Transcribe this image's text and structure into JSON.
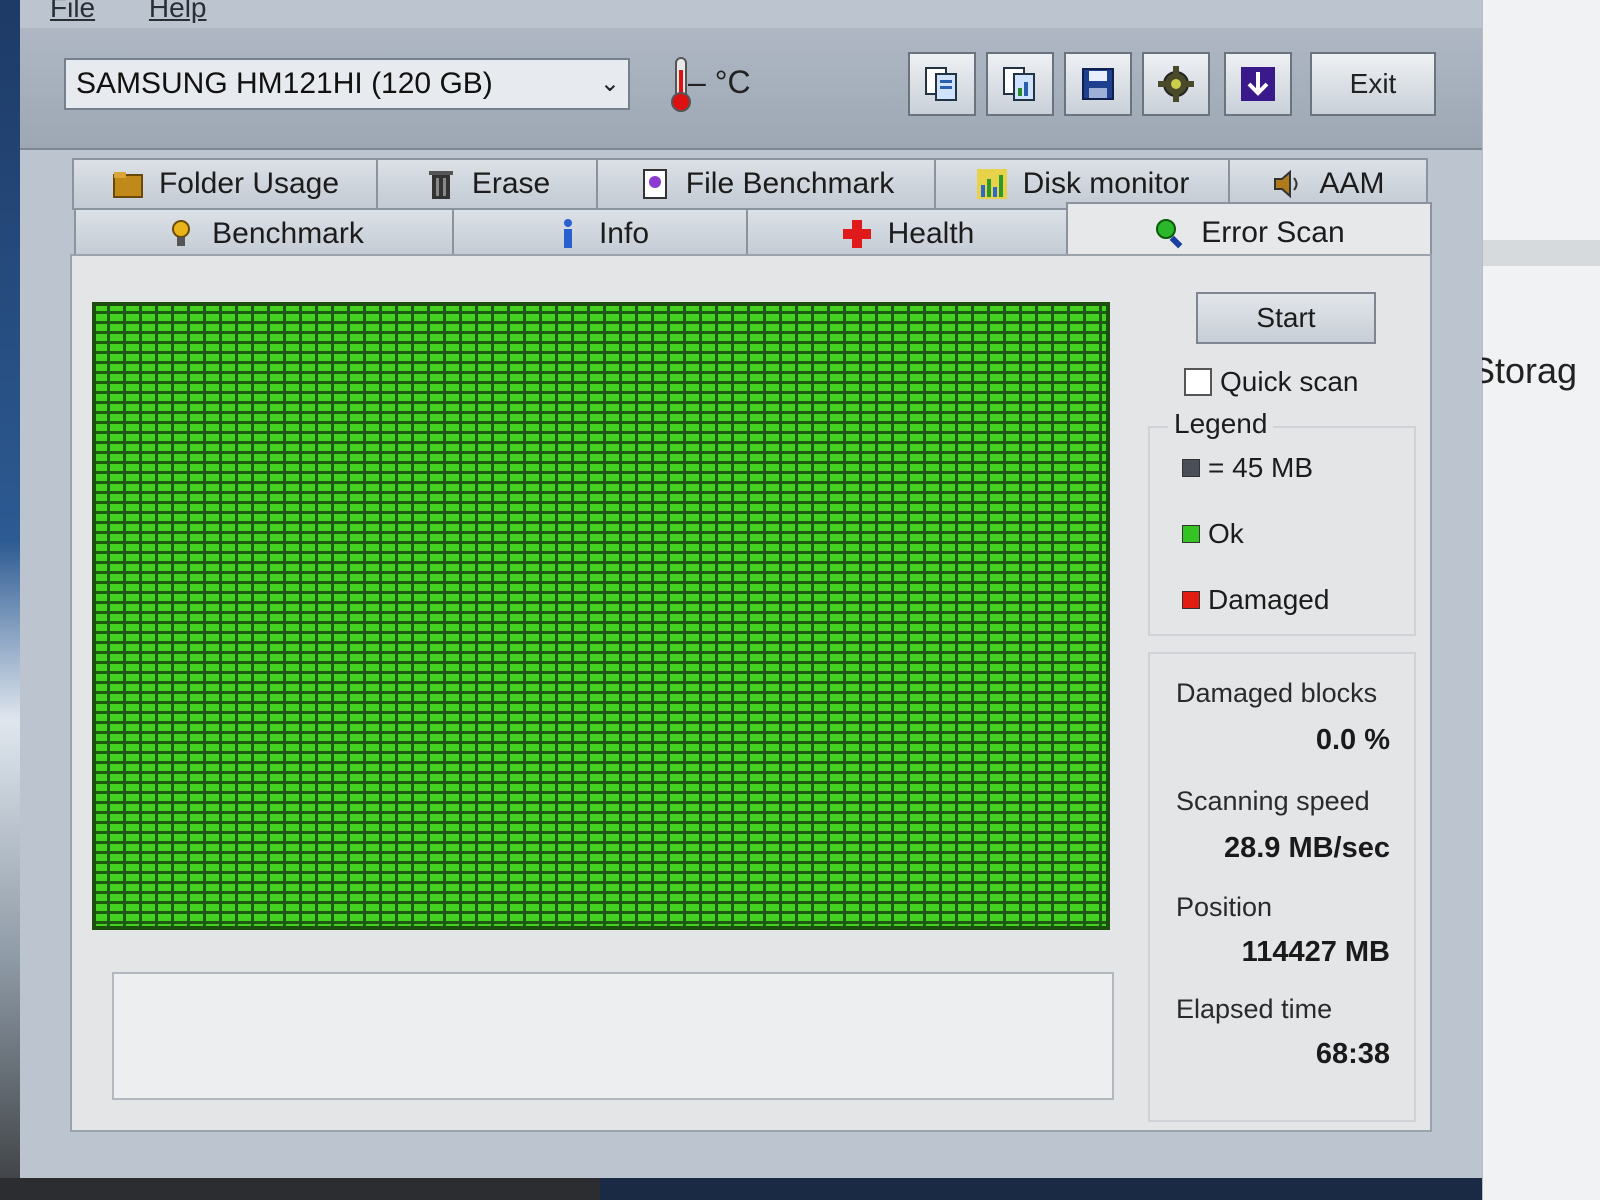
{
  "menu": {
    "file": "File",
    "help": "Help"
  },
  "toolbar": {
    "drive": "SAMSUNG HM121HI (120 GB)",
    "temperature": "– °C",
    "exit_label": "Exit",
    "buttons": [
      "copy-info-icon",
      "copy-screen-icon",
      "save-icon",
      "options-icon",
      "download-icon"
    ]
  },
  "tabs_top": [
    {
      "label": "Folder Usage",
      "icon": "folder-icon"
    },
    {
      "label": "Erase",
      "icon": "trash-icon"
    },
    {
      "label": "File Benchmark",
      "icon": "file-benchmark-icon"
    },
    {
      "label": "Disk monitor",
      "icon": "chart-icon"
    },
    {
      "label": "AAM",
      "icon": "speaker-icon"
    }
  ],
  "tabs_bottom": [
    {
      "label": "Benchmark",
      "icon": "bulb-icon"
    },
    {
      "label": "Info",
      "icon": "info-icon"
    },
    {
      "label": "Health",
      "icon": "health-cross-icon"
    },
    {
      "label": "Error Scan",
      "icon": "magnifier-icon",
      "active": true
    }
  ],
  "scan": {
    "start_label": "Start",
    "quick_scan_label": "Quick scan",
    "quick_scan_checked": false,
    "legend_title": "Legend",
    "legend": [
      {
        "label": "= 45 MB",
        "color": "#4a4f57"
      },
      {
        "label": "Ok",
        "color": "#34c422"
      },
      {
        "label": "Damaged",
        "color": "#e21d12"
      }
    ],
    "stats": {
      "damaged_blocks_label": "Damaged blocks",
      "damaged_blocks_value": "0.0 %",
      "speed_label": "Scanning speed",
      "speed_value": "28.9 MB/sec",
      "position_label": "Position",
      "position_value": "114427 MB",
      "elapsed_label": "Elapsed time",
      "elapsed_value": "68:38"
    }
  },
  "background": {
    "side_text": "Storag"
  }
}
